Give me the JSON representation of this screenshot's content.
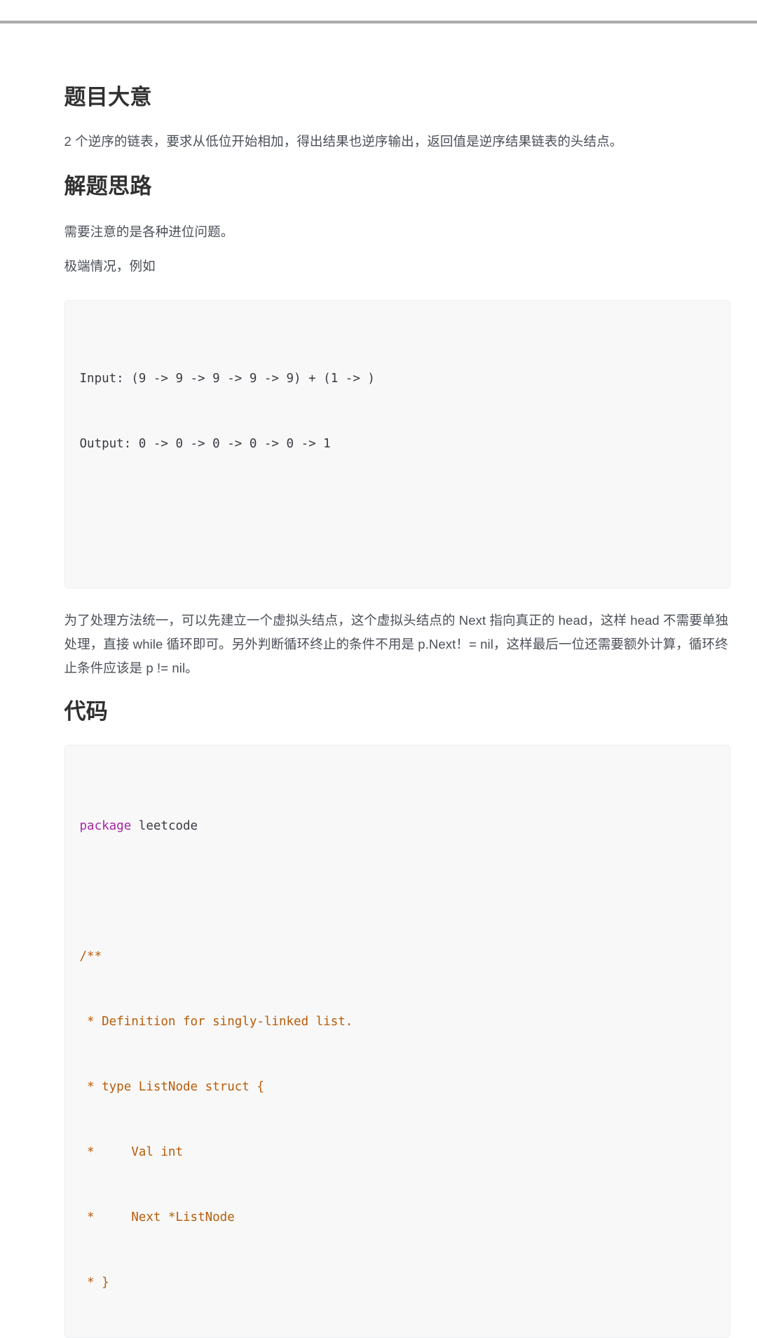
{
  "page": {
    "sections": [
      {
        "id": "problem-summary",
        "heading": "题目大意",
        "paragraphs": [
          "2 个逆序的链表，要求从低位开始相加，得出结果也逆序输出，返回值是逆序结果链表的头结点。"
        ]
      },
      {
        "id": "approach",
        "heading": "解题思路",
        "paragraphs": [
          "需要注意的是各种进位问题。",
          "极端情况，例如"
        ],
        "after_paragraph": "为了处理方法统一，可以先建立一个虚拟头结点，这个虚拟头结点的 Next 指向真正的 head，这样 head 不需要单独处理，直接 while 循环即可。另外判断循环终止的条件不用是 p.Next！= nil，这样最后一位还需要额外计算，循环终止条件应该是 p != nil。"
      },
      {
        "id": "code",
        "heading": "代码"
      }
    ],
    "example_block": {
      "lines": [
        "Input: (9 -> 9 -> 9 -> 9 -> 9) + (1 -> )",
        "Output: 0 -> 0 -> 0 -> 0 -> 0 -> 1"
      ]
    },
    "code_block": {
      "language": "go",
      "tokens": {
        "package_keyword": "package",
        "package_name": " leetcode"
      },
      "comment_lines": [
        "/**",
        " * Definition for singly-linked list.",
        " * type ListNode struct {",
        " *     Val int",
        " *     Next *ListNode",
        " * }"
      ]
    },
    "colors": {
      "background": "#ffffff",
      "heading": "#303030",
      "body_text": "#4a4f57",
      "code_background": "#f8f8f8",
      "code_border": "#eceef0",
      "keyword": "#a626a4",
      "comment": "#b95c08",
      "code_plain": "#383a42",
      "top_rule": "#a8a8a8"
    }
  }
}
